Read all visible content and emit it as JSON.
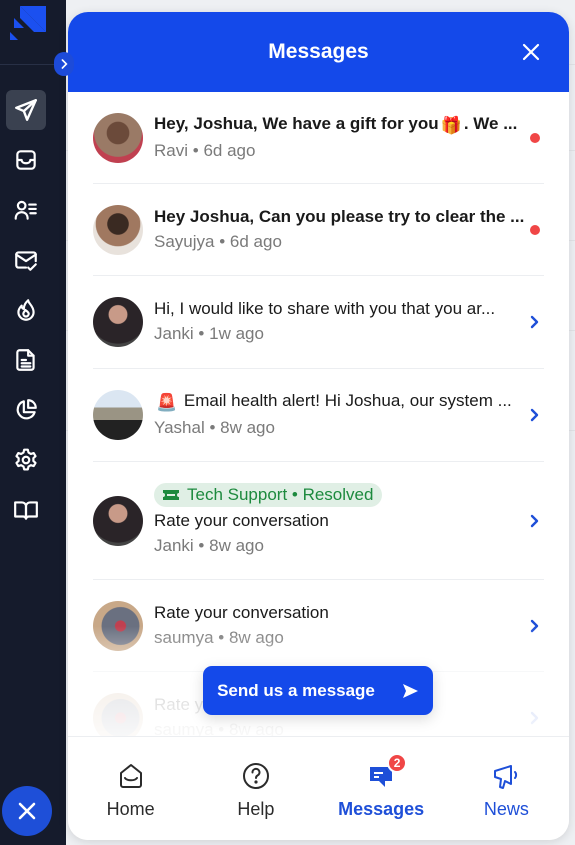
{
  "sidebar": {
    "items": [
      {
        "name": "campaigns",
        "icon": "paper-plane-icon",
        "active": true
      },
      {
        "name": "inbox",
        "icon": "inbox-tray-icon",
        "active": false
      },
      {
        "name": "contacts",
        "icon": "user-list-icon",
        "active": false
      },
      {
        "name": "email-verify",
        "icon": "mail-check-icon",
        "active": false
      },
      {
        "name": "warmup",
        "icon": "flame-icon",
        "active": false
      },
      {
        "name": "templates",
        "icon": "document-icon",
        "active": false
      },
      {
        "name": "reports",
        "icon": "pie-chart-icon",
        "active": false
      },
      {
        "name": "settings",
        "icon": "gear-icon",
        "active": false
      },
      {
        "name": "guides",
        "icon": "book-icon",
        "active": false
      }
    ]
  },
  "messenger": {
    "title": "Messages",
    "messages": [
      {
        "text_before_emoji": "Hey, Joshua, We have a gift for you",
        "emoji": "🎁",
        "text_after_emoji": ". We ...",
        "sender": "Ravi",
        "time": "6d ago",
        "unread": true,
        "avatar_color": "#8a6a58"
      },
      {
        "text": "Hey Joshua, Can you please try to clear the ...",
        "sender": "Sayujya",
        "time": "6d ago",
        "unread": true,
        "avatar_color": "#b89a80"
      },
      {
        "text": "Hi, I would like to share with you that you ar...",
        "sender": "Janki",
        "time": "1w ago",
        "unread": false,
        "avatar_color": "#3a3a42"
      },
      {
        "emoji": "🚨",
        "text": "Email health alert! Hi Joshua, our system ...",
        "sender": "Yashal",
        "time": "8w ago",
        "unread": false,
        "avatar_color": "#8fa3b8"
      },
      {
        "tag": "Tech Support • Resolved",
        "text": "Rate your conversation",
        "sender": "Janki",
        "time": "8w ago",
        "unread": false,
        "avatar_color": "#3a3a42"
      },
      {
        "text": "Rate your conversation",
        "sender": "saumya",
        "time": "8w ago",
        "unread": false,
        "avatar_color": "#7a7f8a"
      },
      {
        "text": "Rate your conversation",
        "sender": "saumya",
        "time": "8w ago",
        "unread": false,
        "avatar_color": "#b0b4ba"
      }
    ],
    "separator": "•",
    "send_button": "Send us a message",
    "tabs": [
      {
        "label": "Home",
        "icon": "home-icon"
      },
      {
        "label": "Help",
        "icon": "help-icon"
      },
      {
        "label": "Messages",
        "icon": "messages-icon",
        "badge": "2",
        "active": true
      },
      {
        "label": "News",
        "icon": "megaphone-icon"
      }
    ]
  },
  "colors": {
    "brand": "#1449ea",
    "sidebar_bg": "#151b2c",
    "unread_dot": "#f04646",
    "tag_bg": "#e0efe5",
    "tag_text": "#1d8a3e"
  }
}
